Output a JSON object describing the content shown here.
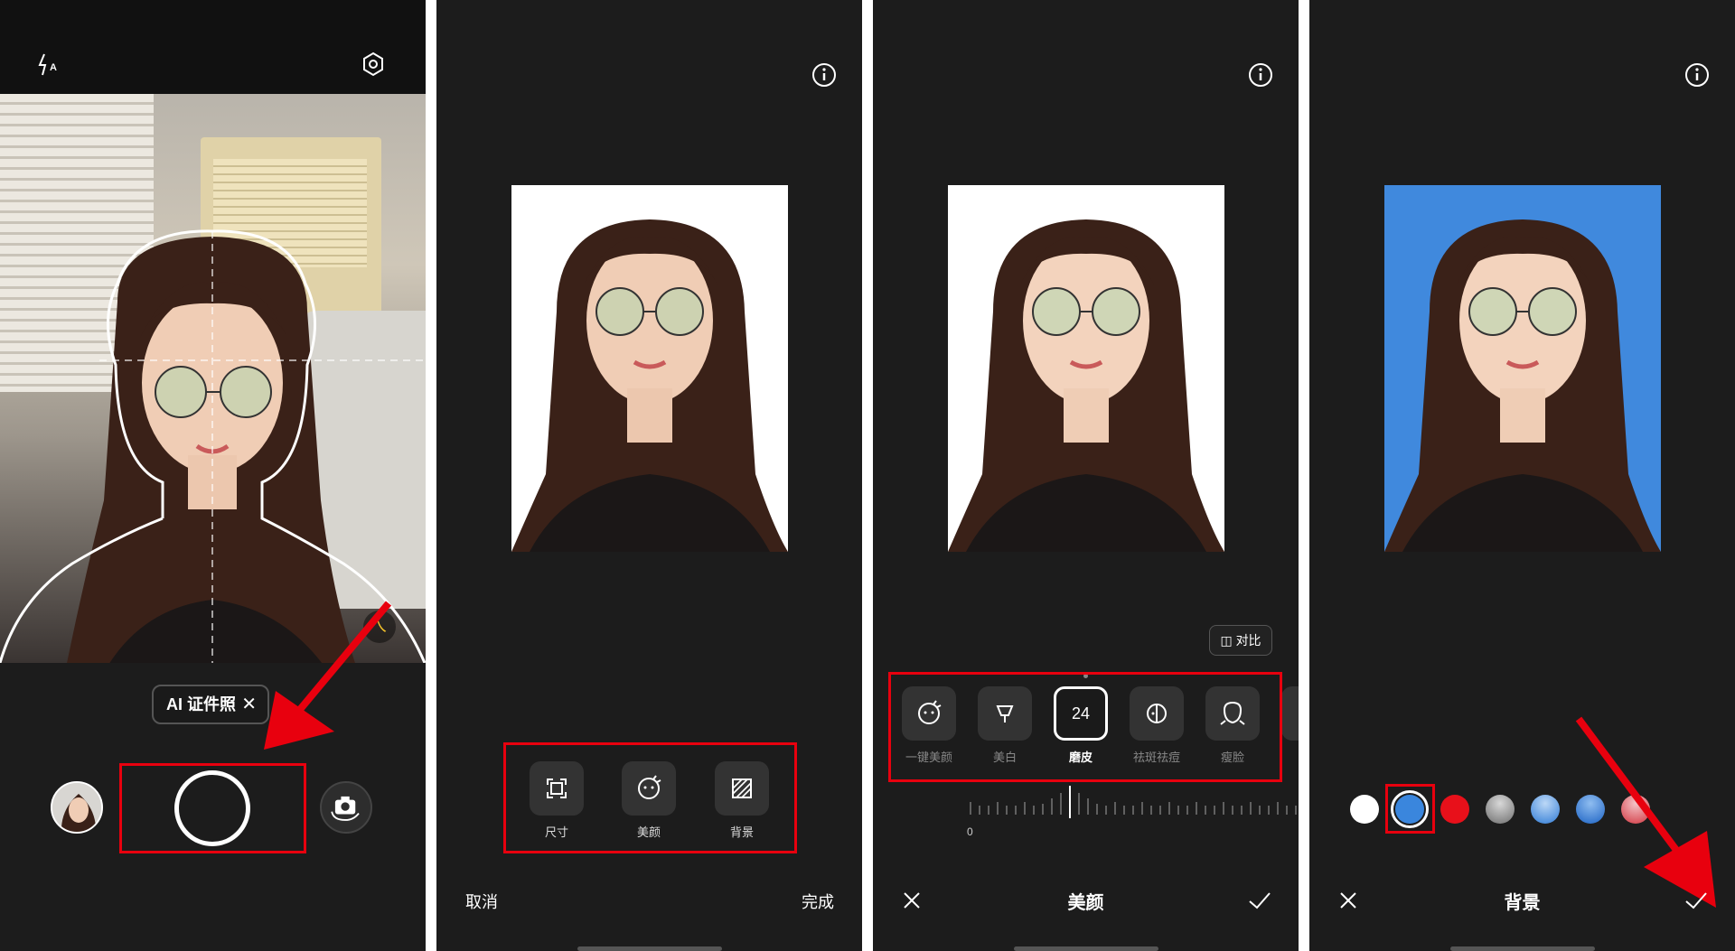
{
  "camera": {
    "mode_chip_label": "AI 证件照",
    "mode_chip_close": "✕",
    "beauty_badge": "ㄟ"
  },
  "size_editor": {
    "tools": [
      {
        "label": "尺寸",
        "icon": "crop-frame-icon"
      },
      {
        "label": "美颜",
        "icon": "beauty-face-icon"
      },
      {
        "label": "背景",
        "icon": "background-hatch-icon"
      }
    ],
    "cancel_label": "取消",
    "done_label": "完成"
  },
  "beauty_editor": {
    "compare_label": "对比",
    "items": [
      {
        "label": "一键美颜",
        "icon": "one-tap-beauty-icon",
        "active": false
      },
      {
        "label": "美白",
        "icon": "whiten-icon",
        "active": false
      },
      {
        "label": "磨皮",
        "value": "24",
        "active": true
      },
      {
        "label": "祛斑祛痘",
        "icon": "blemish-icon",
        "active": false
      },
      {
        "label": "瘦脸",
        "icon": "slim-face-icon",
        "active": false
      }
    ],
    "slider_min_label": "0",
    "title": "美颜"
  },
  "background_editor": {
    "swatches": [
      {
        "name": "white",
        "color": "#ffffff"
      },
      {
        "name": "blue",
        "color": "#3a86dd",
        "selected": true
      },
      {
        "name": "red",
        "color": "#e8101a"
      },
      {
        "name": "gray-gradient",
        "color": "#9a9a9a"
      },
      {
        "name": "blue-gradient-light",
        "color": "#4d94e0"
      },
      {
        "name": "blue-gradient-dark",
        "color": "#2f7bd6"
      },
      {
        "name": "red-gradient",
        "color": "#e8707a"
      }
    ],
    "title": "背景"
  },
  "colors": {
    "highlight": "#e8000e",
    "panel_bg": "#1c1c1c",
    "photo_blue_bg": "#4089dd"
  }
}
